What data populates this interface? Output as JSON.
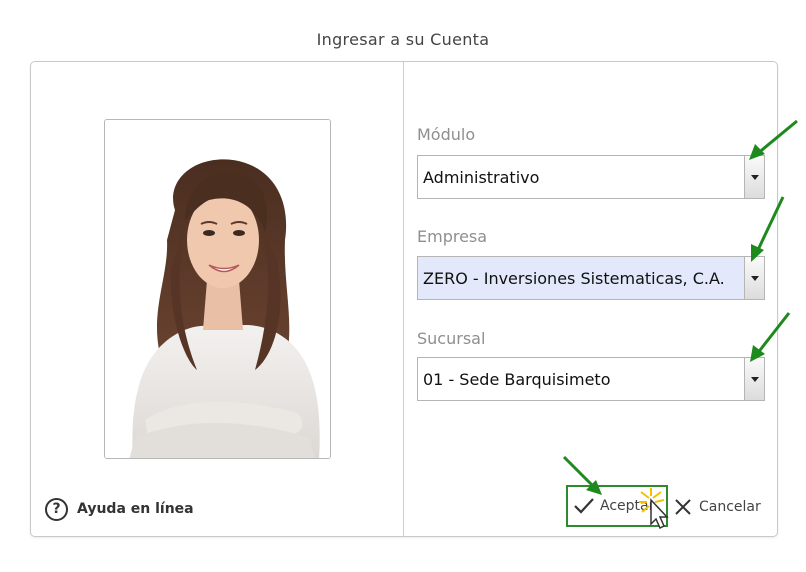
{
  "dialog": {
    "title": "Ingresar a su Cuenta"
  },
  "help": {
    "icon": "question-circle-icon",
    "label": "Ayuda en línea"
  },
  "fields": {
    "modulo": {
      "label": "Módulo",
      "value": "Administrativo"
    },
    "empresa": {
      "label": "Empresa",
      "value": "ZERO - Inversiones Sistematicas, C.A."
    },
    "sucursal": {
      "label": "Sucursal",
      "value": "01 - Sede Barquisimeto"
    }
  },
  "buttons": {
    "accept_label": "Aceptar",
    "cancel_label": "Cancelar"
  },
  "colors": {
    "annotation_green": "#1e8a1e",
    "highlight_field": "#e3e8fb"
  }
}
